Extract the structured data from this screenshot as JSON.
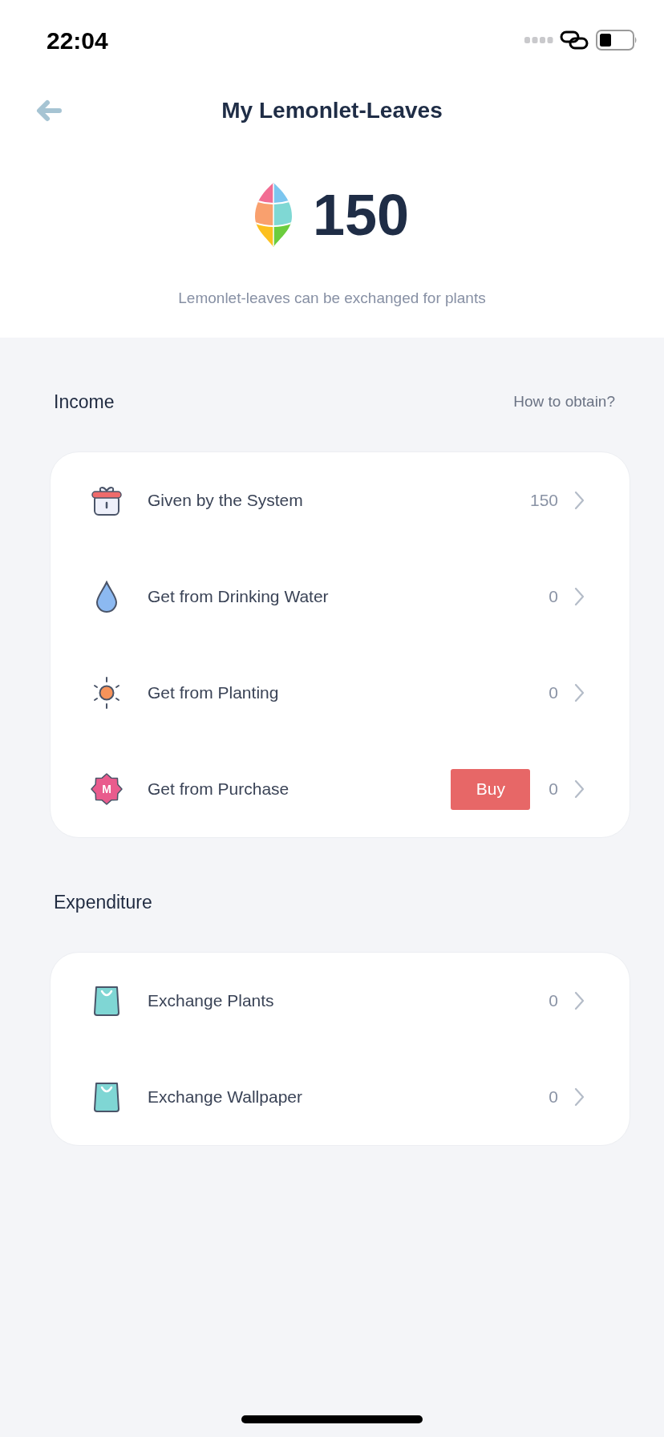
{
  "status_bar": {
    "time": "22:04"
  },
  "header": {
    "title": "My Lemonlet-Leaves"
  },
  "balance": {
    "amount": "150",
    "note": "Lemonlet-leaves can be exchanged for plants"
  },
  "sections": [
    {
      "title": "Income",
      "link": "How to obtain?",
      "rows": [
        {
          "kind": "system",
          "label": "Given by the System",
          "value": "150"
        },
        {
          "kind": "water",
          "label": "Get from Drinking Water",
          "value": "0"
        },
        {
          "kind": "planting",
          "label": "Get from Planting",
          "value": "0"
        },
        {
          "kind": "purchase",
          "icon_text": "M",
          "label": "Get from Purchase",
          "button": "Buy",
          "value": "0"
        }
      ]
    },
    {
      "title": "Expenditure",
      "rows": [
        {
          "kind": "exchange",
          "label": "Exchange Plants",
          "value": "0"
        },
        {
          "kind": "exchange",
          "label": "Exchange Wallpaper",
          "value": "0"
        }
      ]
    }
  ]
}
